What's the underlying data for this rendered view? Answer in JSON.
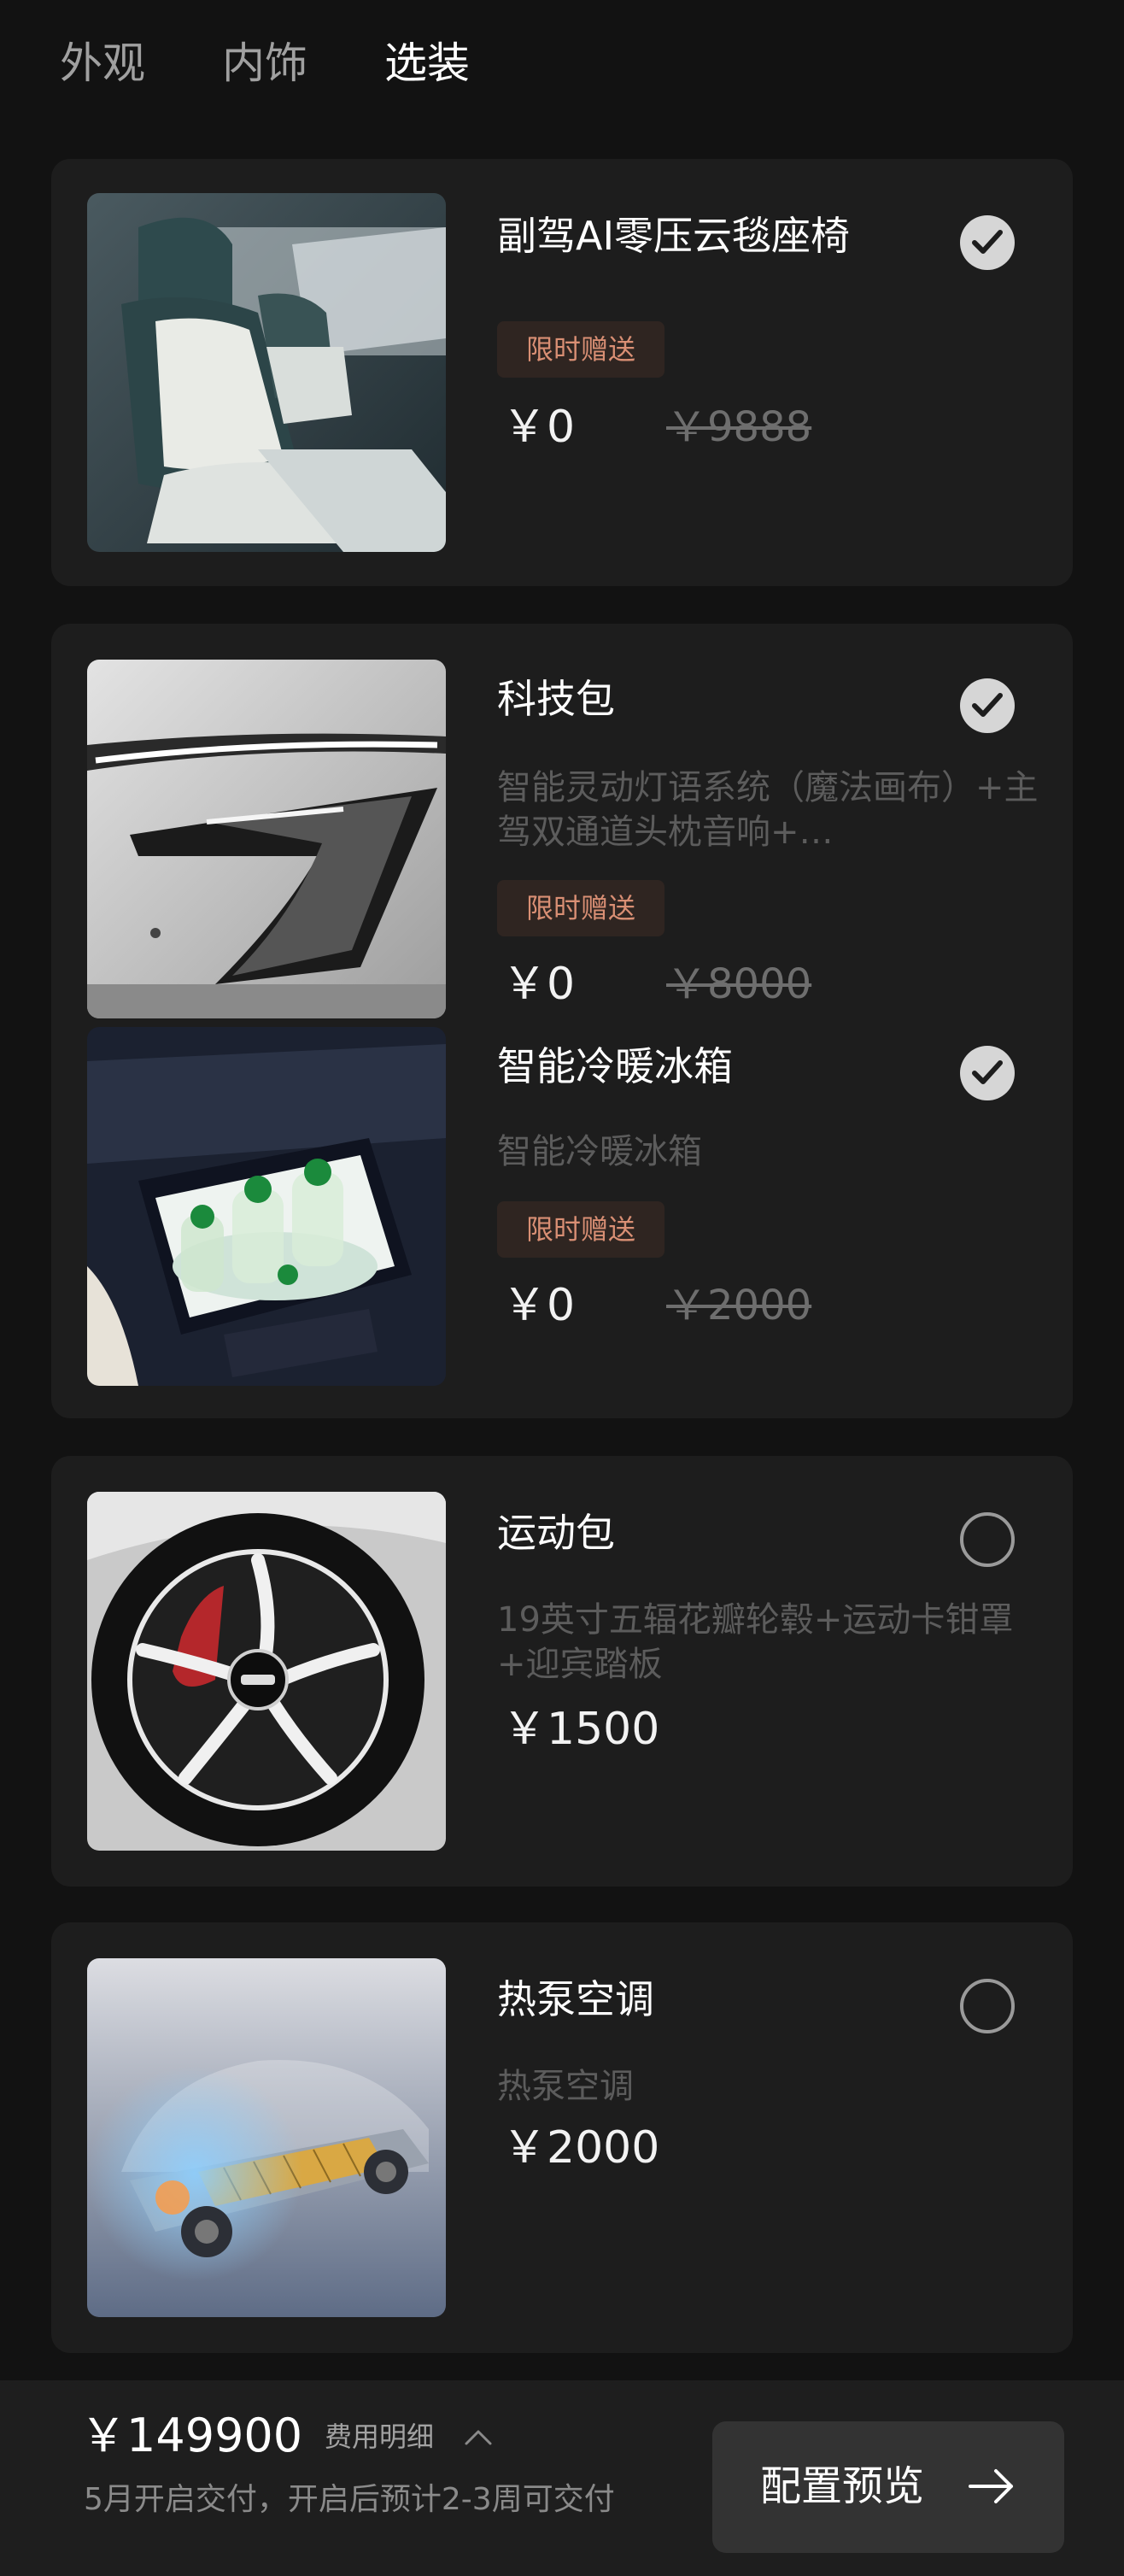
{
  "tabs": [
    {
      "label": "外观",
      "active": false
    },
    {
      "label": "内饰",
      "active": false
    },
    {
      "label": "选装",
      "active": true
    }
  ],
  "options": [
    {
      "title": "副驾AI零压云毯座椅",
      "badge": "限时赠送",
      "price": "￥0",
      "original_price": "￥9888",
      "selected": true,
      "image": "passenger-seat"
    },
    {
      "title": "科技包",
      "description": "智能灵动灯语系统（魔法画布）+主驾双通道头枕音响+…",
      "badge": "限时赠送",
      "price": "￥0",
      "original_price": "￥8000",
      "selected": true,
      "image": "headlight"
    },
    {
      "title": "智能冷暖冰箱",
      "description": "智能冷暖冰箱",
      "badge": "限时赠送",
      "price": "￥0",
      "original_price": "￥2000",
      "selected": true,
      "image": "fridge"
    },
    {
      "title": "运动包",
      "description": "19英寸五辐花瓣轮毂+运动卡钳罩+迎宾踏板",
      "price": "￥1500",
      "selected": false,
      "image": "wheel"
    },
    {
      "title": "热泵空调",
      "description": "热泵空调",
      "price": "￥2000",
      "selected": false,
      "image": "chassis"
    }
  ],
  "footer": {
    "total_price": "￥149900",
    "fee_detail_label": "费用明细",
    "fee_detail_icon": "chevron-up-icon",
    "delivery_text": "5月开启交付，开启后预计2-3周可交付",
    "preview_button_label": "配置预览",
    "preview_button_icon": "arrow-right-icon"
  },
  "colors": {
    "background": "#121212",
    "card": "#1d1d1d",
    "badge_bg": "#2f2521",
    "badge_text": "#d98f74",
    "description": "#5c5c5c",
    "checkbox_selected": "#d6d6d6"
  }
}
